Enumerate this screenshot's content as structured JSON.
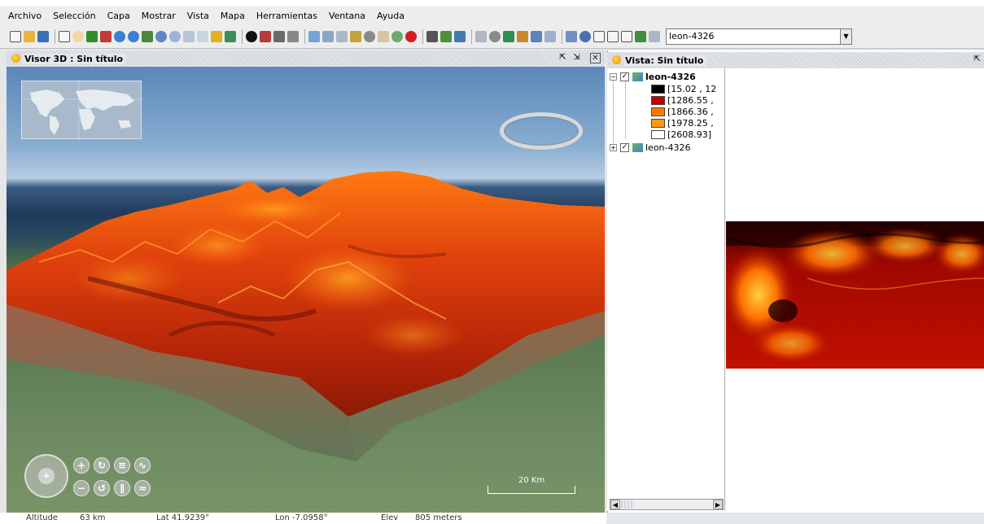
{
  "menu": {
    "items": [
      {
        "label": "Archivo"
      },
      {
        "label": "Selección"
      },
      {
        "label": "Capa"
      },
      {
        "label": "Mostrar"
      },
      {
        "label": "Vista"
      },
      {
        "label": "Mapa"
      },
      {
        "label": "Herramientas"
      },
      {
        "label": "Ventana"
      },
      {
        "label": "Ayuda"
      }
    ]
  },
  "toolbar": {
    "layer_selector_value": "leon-4326"
  },
  "viewer3d": {
    "title": "Visor 3D : Sin título",
    "scale_label": "20 Km"
  },
  "status": {
    "altitude_label": "Altitude",
    "altitude_value": "63 km",
    "lat": "Lat 41.9239°",
    "lon": "Lon -7.0958°",
    "elev_label": "Elev",
    "elev_value": "805 meters"
  },
  "view2d": {
    "title": "Vista: Sin título"
  },
  "toc": {
    "layers": [
      {
        "name": "leon-4326",
        "checked": true,
        "expanded": true,
        "legend": [
          {
            "label": "[15.02 , 12",
            "color": "#000000"
          },
          {
            "label": "[1286.55 ,",
            "color": "#c00000"
          },
          {
            "label": "[1866.36 ,",
            "color": "#ff7a00"
          },
          {
            "label": "[1978.25 ,",
            "color": "#ff9a10"
          },
          {
            "label": "[2608.93]",
            "color": "#ffffff"
          }
        ]
      },
      {
        "name": "leon-4326",
        "checked": true,
        "expanded": false
      }
    ]
  }
}
